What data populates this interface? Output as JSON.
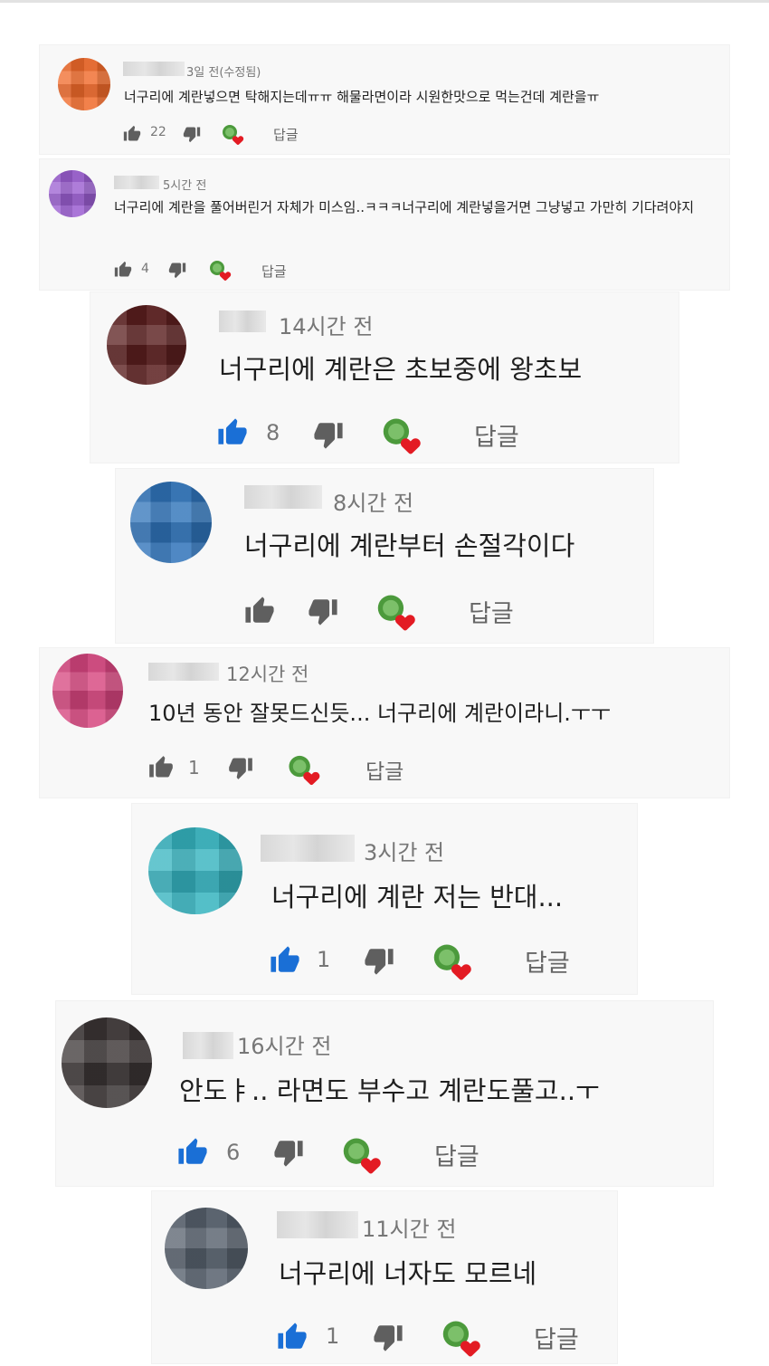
{
  "colors": {
    "card_bg": "#f8f8f8",
    "text": "#1f1f1f",
    "meta_text": "#777777",
    "like_active": "#1a6fd6",
    "like_inactive": "#5f5f5f",
    "heart": "#e31b23",
    "creator_badge": "#4c9a3c"
  },
  "icons": {
    "like": "thumbs-up-icon",
    "dislike": "thumbs-down-icon",
    "creator_heart": "creator-heart-icon"
  },
  "comments": [
    {
      "time": "3일 전(수정됨)",
      "text": "너구리에 계란넣으면 탁해지는데ㅠㅠ 해물라면이라 시원한맛으로 먹는건데 계란을ㅠ",
      "likes": "22",
      "reply_label": "답글",
      "avatar_color": "#f06a2a"
    },
    {
      "time": "5시간 전",
      "text": "너구리에 계란을 풀어버린거 자체가 미스임..ㅋㅋㅋ너구리에 계란넣을거면 그냥넣고 가만히 기다려야지",
      "likes": "4",
      "reply_label": "답글",
      "avatar_color": "#9b5ed1"
    },
    {
      "time": "14시간 전",
      "text": "너구리에 계란은 초보중에 왕초보",
      "likes": "8",
      "reply_label": "답글",
      "avatar_color": "#5a1e1e"
    },
    {
      "time": "8시간 전",
      "text": "너구리에 계란부터 손절각이다",
      "likes": "",
      "reply_label": "답글",
      "avatar_color": "#2f73b9"
    },
    {
      "time": "12시간 전",
      "text": "10년 동안 잘못드신듯... 너구리에 계란이라니.ㅜㅜ",
      "likes": "1",
      "reply_label": "답글",
      "avatar_color": "#d6457e"
    },
    {
      "time": "3시간 전",
      "text": "너구리에 계란 저는 반대...",
      "likes": "1",
      "reply_label": "답글",
      "avatar_color": "#35b3bf"
    },
    {
      "time": "16시간 전",
      "text": "안도ㅑ.. 라면도 부수고 계란도풀고..ㅜ",
      "likes": "6",
      "reply_label": "답글",
      "avatar_color": "#3a3434"
    },
    {
      "time": "11시간 전",
      "text": "너구리에 너자도 모르네",
      "likes": "1",
      "reply_label": "답글",
      "avatar_color": "#56606c"
    }
  ]
}
